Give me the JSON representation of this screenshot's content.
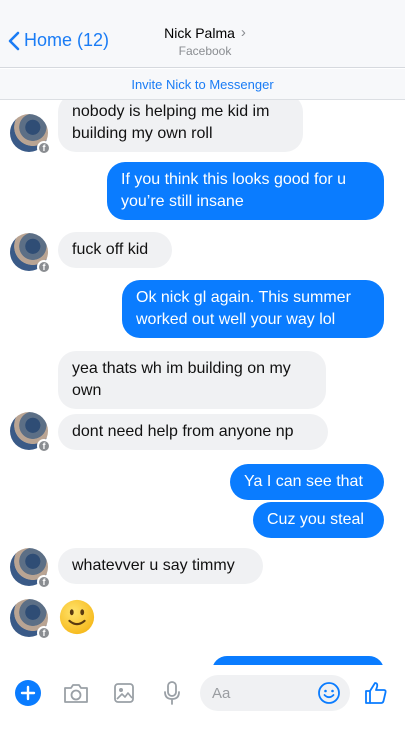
{
  "header": {
    "back_label": "Home (12)",
    "contact_name": "Nick Palma",
    "contact_sub": "Facebook"
  },
  "invite": {
    "label": "Invite Nick to Messenger"
  },
  "messages": [
    {
      "side": "in",
      "text": "nobody is helping me kid im building my own roll"
    },
    {
      "side": "out",
      "text": "If you think this looks good for u you’re still insane"
    },
    {
      "side": "in",
      "text": "fuck off kid"
    },
    {
      "side": "out",
      "text": "Ok nick gl again. This summer worked out well your way lol"
    },
    {
      "side": "in",
      "text": "yea thats wh im building on my own"
    },
    {
      "side": "in",
      "text": "dont need help from anyone np"
    },
    {
      "side": "out",
      "text": "Ya I can see that"
    },
    {
      "side": "out",
      "text": "Cuz you steal"
    },
    {
      "side": "in",
      "text": "whatevver u say timmy"
    },
    {
      "side": "in",
      "emoji": "slightly-smiling-face"
    }
  ],
  "composer": {
    "placeholder": "Aa",
    "icons": [
      "plus-icon",
      "camera-icon",
      "image-icon",
      "microphone-icon",
      "emoji-icon",
      "thumbs-up-icon"
    ]
  },
  "colors": {
    "accent": "#0a7cff",
    "incoming_bubble": "#f0f1f3",
    "header_bg": "#f7f8fa"
  }
}
